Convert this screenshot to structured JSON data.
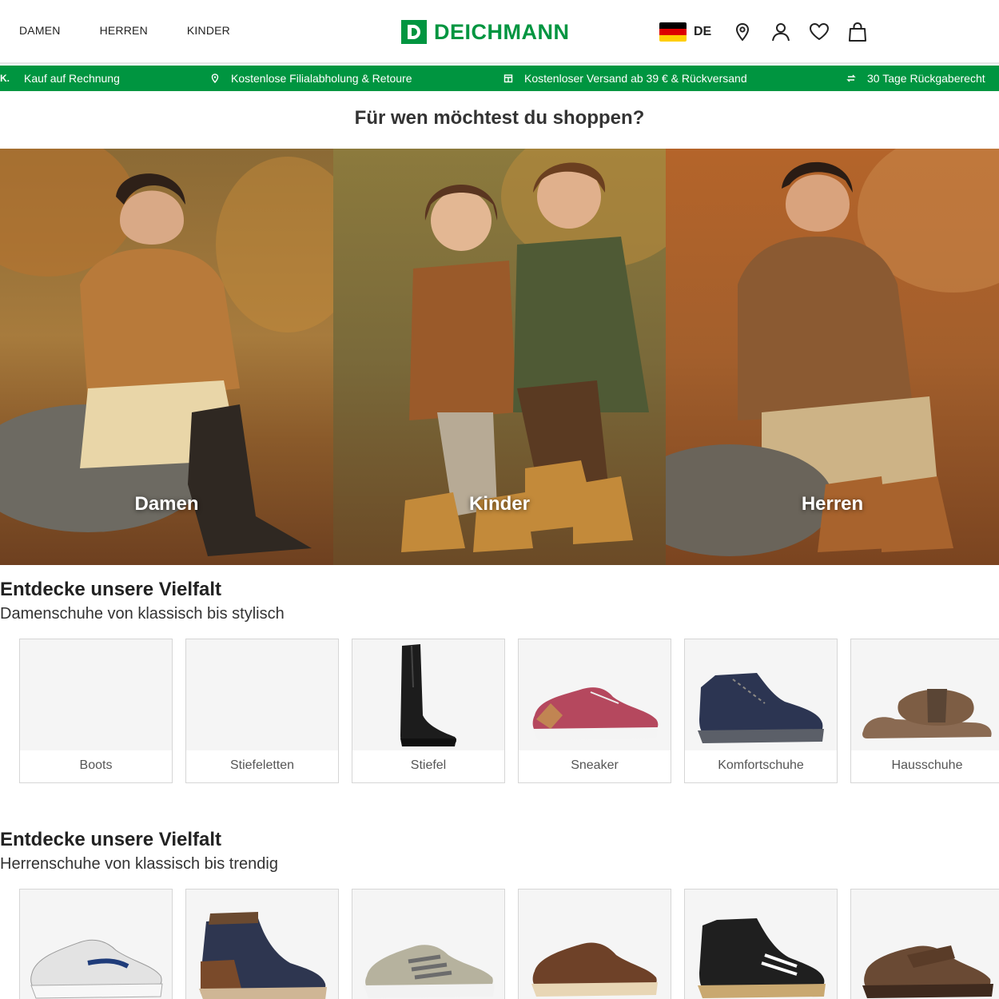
{
  "header": {
    "nav": [
      "DAMEN",
      "HERREN",
      "KINDER"
    ],
    "logo_text": "DEICHMANN",
    "country": "DE",
    "colors": {
      "brand": "#009540",
      "flag": [
        "#000000",
        "#dd0000",
        "#ffce00"
      ]
    },
    "icons": [
      "location-pin-icon",
      "user-icon",
      "heart-icon",
      "shopping-bag-icon"
    ]
  },
  "usp_bar": {
    "items": [
      {
        "icon": "invoice-icon",
        "text": "Kauf auf Rechnung",
        "prefix": "K."
      },
      {
        "icon": "location-pin-icon",
        "text": "Kostenlose Filialabholung & Retoure"
      },
      {
        "icon": "store-icon",
        "text": "Kostenloser Versand ab 39 € & Rückversand"
      },
      {
        "icon": "exchange-icon",
        "text": "30 Tage Rückgaberecht"
      }
    ]
  },
  "shop_for": {
    "title": "Für wen möchtest du shoppen?",
    "tiles": [
      {
        "label": "Damen"
      },
      {
        "label": "Kinder"
      },
      {
        "label": "Herren"
      }
    ]
  },
  "women_section": {
    "title": "Entdecke unsere Vielfalt",
    "subtitle": "Damenschuhe von klassisch bis stylisch",
    "categories": [
      "Boots",
      "Stiefeletten",
      "Stiefel",
      "Sneaker",
      "Komfortschuhe",
      "Hausschuhe"
    ]
  },
  "men_section": {
    "title": "Entdecke unsere Vielfalt",
    "subtitle": "Herrenschuhe von klassisch bis trendig"
  }
}
